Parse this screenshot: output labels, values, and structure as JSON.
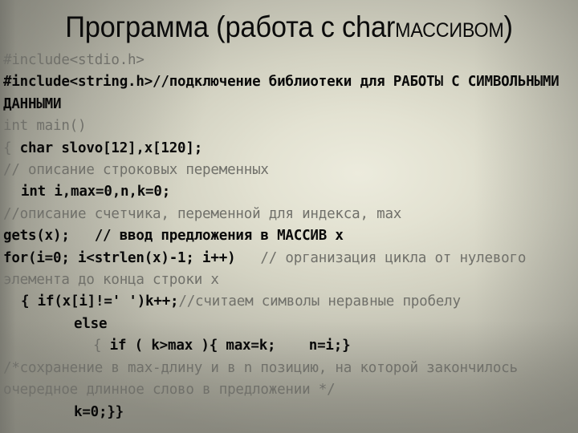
{
  "slide": {
    "title": {
      "part1": "Программа (работа с ",
      "part2": "char",
      "part3": "МАССИВОМ",
      "part4": ")"
    },
    "colors": {
      "bold_text": "#090909",
      "normal_text": "#70706a",
      "background_light": "#ecebdd",
      "background_dark": "#9b9a8e"
    },
    "code_lines": [
      {
        "id": "line-include-stdio",
        "indent": 0,
        "spans": [
          {
            "style": "normal",
            "text": "#include<stdio.h>"
          }
        ]
      },
      {
        "id": "line-include-string",
        "indent": 0,
        "spans": [
          {
            "style": "bold",
            "text": "#include<string.h>//подключение библиотеки для РАБОТЫ С СИМВОЛЬНЫМИ ДАННЫМИ"
          }
        ]
      },
      {
        "id": "line-int-main",
        "indent": 0,
        "spans": [
          {
            "style": "normal",
            "text": "int main()"
          }
        ]
      },
      {
        "id": "line-char-decl",
        "indent": 0,
        "spans": [
          {
            "style": "normal",
            "text": "{ "
          },
          {
            "style": "bold",
            "text": "char slovo[12],x[120];"
          }
        ]
      },
      {
        "id": "line-comment-strings",
        "indent": 0,
        "spans": [
          {
            "style": "normal",
            "text": "// описание строковых переменных"
          }
        ]
      },
      {
        "id": "line-int-vars",
        "indent": 1,
        "spans": [
          {
            "style": "bold",
            "text": "int i,max=0,n,k=0;"
          }
        ]
      },
      {
        "id": "line-comment-counter",
        "indent": 0,
        "spans": [
          {
            "style": "normal",
            "text": "//описание счетчика, переменной для индекса, max"
          }
        ]
      },
      {
        "id": "line-gets",
        "indent": 0,
        "spans": [
          {
            "style": "bold",
            "text": "gets(x);   // ввод предложения в МАССИВ x"
          }
        ]
      },
      {
        "id": "line-for",
        "indent": 0,
        "spans": [
          {
            "style": "bold",
            "text": "for(i=0; i<strlen(x)-1; i++)"
          },
          {
            "style": "normal",
            "text": "   // организация цикла от нулевого элемента до конца строки x"
          }
        ]
      },
      {
        "id": "line-if-not-space",
        "indent": 1,
        "spans": [
          {
            "style": "bold",
            "text": "{ if(x[i]!=' ')k++;"
          },
          {
            "style": "normal",
            "text": "//считаем символы неравные пробелу"
          }
        ]
      },
      {
        "id": "line-else",
        "indent": 3,
        "spans": [
          {
            "style": "bold",
            "text": "else"
          }
        ]
      },
      {
        "id": "line-if-kmax",
        "indent": 4,
        "spans": [
          {
            "style": "normal",
            "text": "{ "
          },
          {
            "style": "bold",
            "text": "if ( k>max ){ max=k;    n=i;}"
          }
        ]
      },
      {
        "id": "line-comment-save",
        "indent": 0,
        "spans": [
          {
            "style": "normal",
            "text": "/*сохранение в max-длину и в n позицию, на которой закончилось очередное длинное слово в предложении */"
          }
        ]
      },
      {
        "id": "line-k-reset",
        "indent": 3,
        "spans": [
          {
            "style": "bold",
            "text": "k=0;}}"
          }
        ]
      }
    ]
  }
}
